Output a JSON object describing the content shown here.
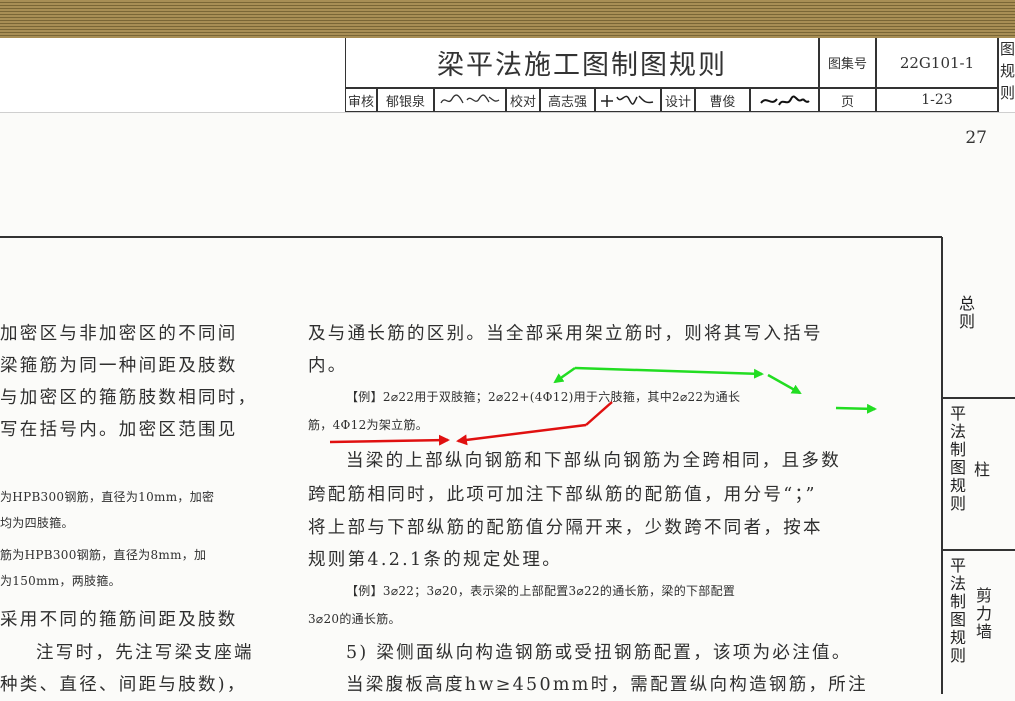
{
  "title_block": {
    "title": "梁平法施工图制图规则",
    "atlas_label": "图集号",
    "atlas_no": "22G101-1",
    "page_label": "页",
    "page_range": "1-23",
    "edge_chars": [
      "图",
      "规",
      "则"
    ],
    "review_label": "审核",
    "review_name": "郁银泉",
    "check_label": "校对",
    "check_name": "高志强",
    "design_label": "设计",
    "design_name": "曹俊"
  },
  "page_number": "27",
  "left_column": [
    "加密区与非加密区的不同间",
    "梁箍筋为同一种间距及肢数",
    "与加密区的箍筋肢数相同时，",
    "写在括号内。加密区范围见",
    "为HPB300钢筋，直径为10mm，加密",
    "均为四肢箍。",
    "筋为HPB300钢筋，直径为8mm，加",
    "为150mm，两肢箍。",
    "采用不同的箍筋间距及肢数",
    "注写时，先注写梁支座端",
    "种类、直径、间距与肢数)，"
  ],
  "right_column": [
    "及与通长筋的区别。当全部采用架立筋时，则将其写入括号",
    "内。",
    "【例】2⌀22用于双肢箍；2⌀22+(4Φ12)用于六肢箍，其中2⌀22为通长",
    "筋，4Φ12为架立筋。",
    "当梁的上部纵向钢筋和下部纵向钢筋为全跨相同，且多数",
    "跨配筋相同时，此项可加注下部纵筋的配筋值，用分号“；”",
    "将上部与下部纵筋的配筋值分隔开来，少数跨不同者，按本",
    "规则第4.2.1条的规定处理。",
    "【例】3⌀22；3⌀20，表示梁的上部配置3⌀22的通长筋，梁的下部配置",
    "3⌀20的通长筋。",
    "5) 梁侧面纵向构造钢筋或受扭钢筋配置，该项为必注值。",
    "当梁腹板高度hw≥450mm时，需配置纵向构造钢筋，所注"
  ],
  "side_tabs": {
    "general": [
      "总",
      "则"
    ],
    "column_left": [
      "平",
      "法",
      "制",
      "图",
      "规",
      "则"
    ],
    "column_right": [
      "柱"
    ],
    "wall_left": [
      "平",
      "法",
      "制",
      "图",
      "规",
      "则"
    ],
    "wall_right": [
      "剪",
      "力",
      "墙"
    ]
  },
  "colors": {
    "annotation_green": "#22dd22",
    "annotation_red": "#e01010",
    "header_band": "#8f7845"
  }
}
